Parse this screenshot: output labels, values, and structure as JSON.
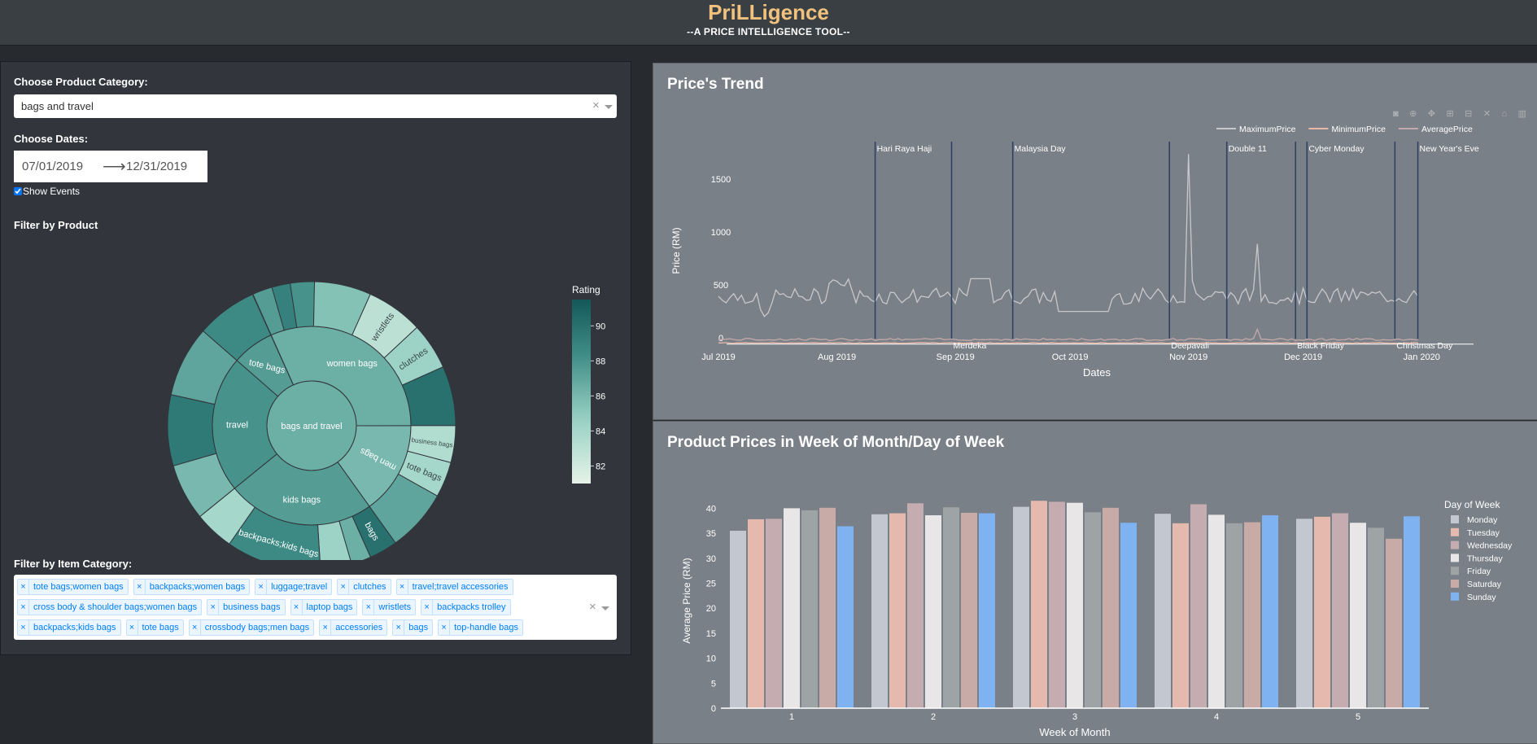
{
  "header": {
    "title": "PriLLigence",
    "subtitle": "--A PRICE INTELLIGENCE TOOL--"
  },
  "filters": {
    "category_label": "Choose Product Category:",
    "category_value": "bags and travel",
    "dates_label": "Choose Dates:",
    "date_start": "07/01/2019",
    "date_arrow": "⟶",
    "date_end": "12/31/2019",
    "show_events_label": "Show Events",
    "show_events_checked": true,
    "product_filter_label": "Filter by Product",
    "item_category_label": "Filter by Item Category:",
    "item_categories": [
      "tote bags;women bags",
      "backpacks;women bags",
      "luggage;travel",
      "clutches",
      "travel;travel accessories",
      "cross body & shoulder bags;women bags",
      "business bags",
      "laptop bags",
      "wristlets",
      "backpacks trolley",
      "backpacks;kids bags",
      "tote bags",
      "crossbody bags;men bags",
      "accessories",
      "bags",
      "top-handle bags"
    ]
  },
  "sunburst": {
    "center": "bags and travel",
    "groups": [
      {
        "name": "women bags",
        "rating": 86.5,
        "children": [
          {
            "name": "",
            "rating": 87.5
          },
          {
            "name": "",
            "rating": 89
          },
          {
            "name": "",
            "rating": 88
          },
          {
            "name": "",
            "rating": 85.5
          },
          {
            "name": "wristlets",
            "rating": 83
          },
          {
            "name": "clutches",
            "rating": 84.5
          },
          {
            "name": "",
            "rating": 90
          }
        ]
      },
      {
        "name": "men bags",
        "rating": 86,
        "children": [
          {
            "name": "business bags",
            "rating": 83.5
          },
          {
            "name": "tote bags",
            "rating": 84
          },
          {
            "name": "",
            "rating": 87
          }
        ]
      },
      {
        "name": "kids bags",
        "rating": 87.5,
        "children": [
          {
            "name": "bags",
            "rating": 90
          },
          {
            "name": "",
            "rating": 86.5
          },
          {
            "name": "",
            "rating": 84.5
          },
          {
            "name": "backpacks;kids bags",
            "rating": 88.5
          },
          {
            "name": "",
            "rating": 84
          }
        ]
      },
      {
        "name": "travel",
        "rating": 88,
        "children": [
          {
            "name": "",
            "rating": 86
          },
          {
            "name": "",
            "rating": 89.5
          },
          {
            "name": "",
            "rating": 87
          }
        ]
      },
      {
        "name": "tote bags",
        "rating": 87.5,
        "children": [
          {
            "name": "",
            "rating": 88.5
          }
        ]
      }
    ],
    "colorbar": {
      "title": "Rating",
      "ticks": [
        82,
        84,
        86,
        88,
        90
      ],
      "min": 81,
      "max": 91.5
    }
  },
  "trend_chart": {
    "title": "Price's Trend",
    "chart_data": {
      "type": "line",
      "xlabel": "Dates",
      "ylabel": "Price (RM)",
      "x_range": [
        "2019-07-01",
        "2020-01-15"
      ],
      "y_range": [
        -40,
        1810
      ],
      "x_ticks": [
        "Jul 2019",
        "Aug 2019",
        "Sep 2019",
        "Oct 2019",
        "Nov 2019",
        "Dec 2019",
        "Jan 2020"
      ],
      "y_ticks": [
        0,
        500,
        1000,
        1500
      ],
      "legend_position": "top-right",
      "series": [
        {
          "name": "MaximumPrice",
          "color": "#c8c8cc",
          "kind": "max"
        },
        {
          "name": "MinimumPrice",
          "color": "#e8b7a8",
          "kind": "min"
        },
        {
          "name": "AveragePrice",
          "color": "#c4aaaa",
          "kind": "avg"
        }
      ],
      "spikes": [
        {
          "date": "2019-11-01",
          "value": 1800
        },
        {
          "date": "2019-11-19",
          "value": 950
        }
      ],
      "events": [
        {
          "date": "2019-08-11",
          "label": "Hari Raya Haji",
          "label_pos": "top"
        },
        {
          "date": "2019-08-31",
          "label": "Merdeka",
          "label_pos": "bottom"
        },
        {
          "date": "2019-09-16",
          "label": "Malaysia Day",
          "label_pos": "top"
        },
        {
          "date": "2019-10-27",
          "label": "Deepavali",
          "label_pos": "bottom"
        },
        {
          "date": "2019-11-11",
          "label": "Double 11",
          "label_pos": "top"
        },
        {
          "date": "2019-11-29",
          "label": "Black Friday",
          "label_pos": "bottom"
        },
        {
          "date": "2019-12-02",
          "label": "Cyber Monday",
          "label_pos": "top"
        },
        {
          "date": "2019-12-25",
          "label": "Christmas Day",
          "label_pos": "bottom"
        },
        {
          "date": "2019-12-31",
          "label": "New Year's Eve",
          "label_pos": "top"
        }
      ]
    }
  },
  "weekly_chart": {
    "title": "Product Prices in Week of Month/Day of Week",
    "chart_data": {
      "type": "bar",
      "xlabel": "Week of Month",
      "ylabel": "Average Price (RM)",
      "categories": [
        "1",
        "2",
        "3",
        "4",
        "5"
      ],
      "ylim": [
        0,
        43
      ],
      "y_ticks": [
        0,
        5,
        10,
        15,
        20,
        25,
        30,
        35,
        40
      ],
      "legend_title": "Day of Week",
      "legend_position": "right",
      "series": [
        {
          "name": "Monday",
          "color": "#c3c7d0",
          "values": [
            35.5,
            38.8,
            40.3,
            38.9,
            37.9
          ]
        },
        {
          "name": "Tuesday",
          "color": "#e5b9ae",
          "values": [
            37.8,
            39.0,
            41.5,
            37.0,
            38.3
          ]
        },
        {
          "name": "Wednesday",
          "color": "#c5acb0",
          "values": [
            37.9,
            41.0,
            41.3,
            40.8,
            39.0
          ]
        },
        {
          "name": "Thursday",
          "color": "#e8e6e6",
          "values": [
            40.0,
            38.6,
            41.1,
            38.7,
            37.1
          ]
        },
        {
          "name": "Friday",
          "color": "#9ea3a5",
          "values": [
            39.6,
            40.2,
            39.2,
            37.0,
            36.1
          ]
        },
        {
          "name": "Saturday",
          "color": "#c8aba6",
          "values": [
            40.1,
            39.1,
            40.1,
            37.2,
            33.9
          ]
        },
        {
          "name": "Sunday",
          "color": "#7eb2f0",
          "values": [
            36.4,
            39.0,
            37.1,
            38.6,
            38.4
          ]
        }
      ]
    }
  }
}
